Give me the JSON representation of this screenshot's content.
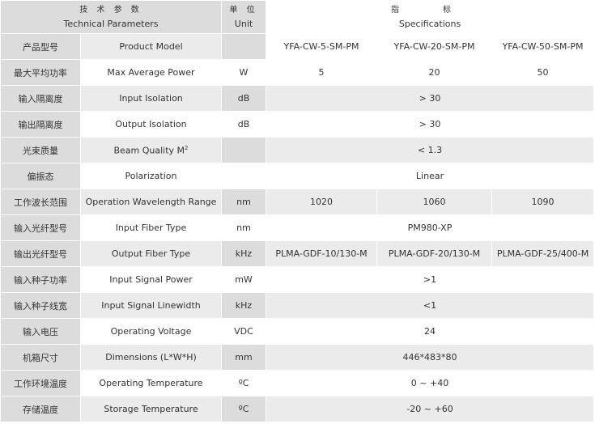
{
  "header": {
    "param_zh": "技 术 参 数",
    "param_en": "Technical Parameters",
    "unit_zh": "单 位",
    "unit_en": "Unit",
    "spec_zh": "指　标",
    "spec_en": "Specifications"
  },
  "rows": [
    {
      "zh": "产品型号",
      "en": "Product Model",
      "unit": "",
      "values": [
        "YFA-CW-5-SM-PM",
        "YFA-CW-20-SM-PM",
        "YFA-CW-50-SM-PM"
      ]
    },
    {
      "zh": "最大平均功率",
      "en": "Max Average Power",
      "unit": "W",
      "values": [
        "5",
        "20",
        "50"
      ]
    },
    {
      "zh": "输入隔离度",
      "en": "Input Isolation",
      "unit": "dB",
      "value": "> 30"
    },
    {
      "zh": "输出隔离度",
      "en": "Output Isolation",
      "unit": "dB",
      "value": "> 30"
    },
    {
      "zh": "光束质量",
      "en": "Beam Quality M",
      "en_sup": "2",
      "unit": "",
      "value": "< 1.3"
    },
    {
      "zh": "偏振态",
      "en": "Polarization",
      "unit": "",
      "value": "Linear"
    },
    {
      "zh": "工作波长范围",
      "en": "Operation Wavelength Range",
      "unit": "nm",
      "values": [
        "1020",
        "1060",
        "1090"
      ]
    },
    {
      "zh": "输入光纤型号",
      "en": "Input Fiber Type",
      "unit": "nm",
      "value": "PM980-XP"
    },
    {
      "zh": "输出光纤型号",
      "en": "Output Fiber Type",
      "unit": "kHz",
      "values": [
        "PLMA-GDF-10/130-M",
        "PLMA-GDF-20/130-M",
        "PLMA-GDF-25/400-M"
      ]
    },
    {
      "zh": "输入种子功率",
      "en": "Input Signal Power",
      "unit": "mW",
      "value": ">1"
    },
    {
      "zh": "输入种子线宽",
      "en": "Input Signal Linewidth",
      "unit": "kHz",
      "value": "<1"
    },
    {
      "zh": "输入电压",
      "en": "Operating Voltage",
      "unit": "VDC",
      "value": "24"
    },
    {
      "zh": "机箱尺寸",
      "en": "Dimensions (L*W*H)",
      "unit": "mm",
      "value": "446*483*80"
    },
    {
      "zh": "工作环境温度",
      "en": "Operating Temperature",
      "unit": "ºC",
      "value": "0 ~ +40"
    },
    {
      "zh": "存储温度",
      "en": "Storage Temperature",
      "unit": "ºC",
      "value": "-20 ~ +60"
    }
  ]
}
